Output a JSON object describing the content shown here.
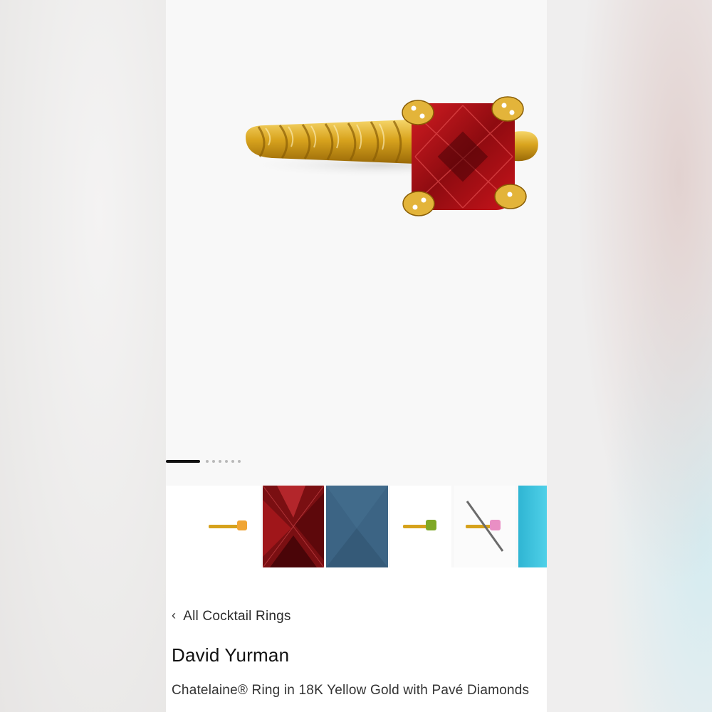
{
  "product_images": {
    "main_image": "ring-garnet-yellow-gold",
    "carousel": {
      "active_index": 0,
      "total": 6
    }
  },
  "thumbnails": [
    {
      "variant": "citrine-ring"
    },
    {
      "variant": "garnet-closeup"
    },
    {
      "variant": "blue-topaz-closeup"
    },
    {
      "variant": "peridot-ring"
    },
    {
      "variant": "pink-tourmaline-ring"
    },
    {
      "variant": "turquoise-closeup"
    }
  ],
  "breadcrumb": {
    "icon": "chevron-left-icon",
    "label": "All Cocktail Rings"
  },
  "product": {
    "brand": "David Yurman",
    "name": "Chatelaine® Ring in 18K Yellow Gold with Pavé Diamonds"
  },
  "colors": {
    "gold": "#d6a21c",
    "garnet": "#9b0f14",
    "active_indicator": "#111111"
  }
}
